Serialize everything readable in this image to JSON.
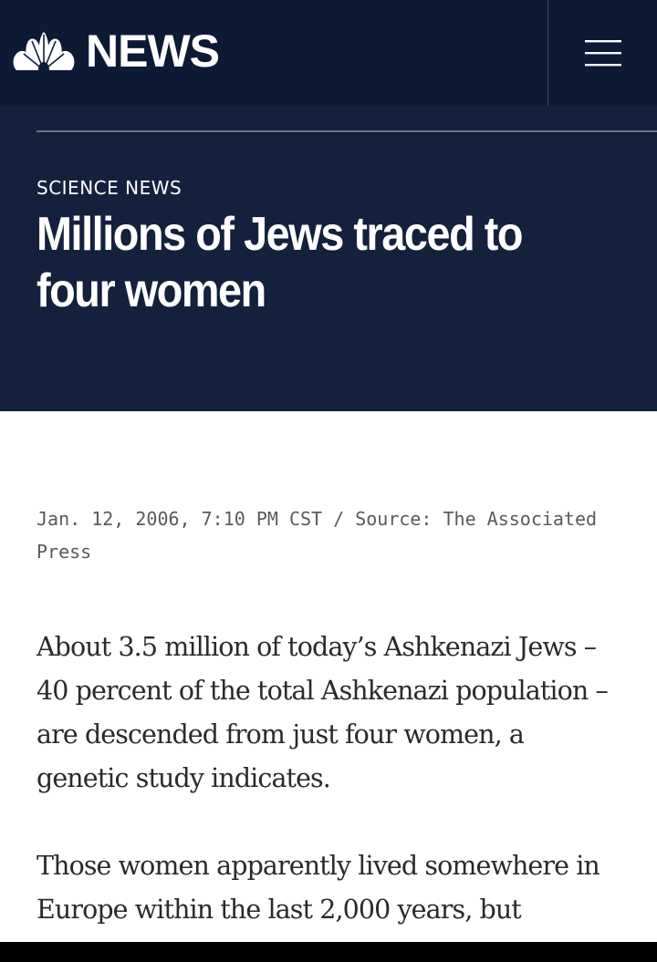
{
  "header": {
    "logo_text": "NEWS",
    "logo_icon": "peacock-icon",
    "menu_icon": "hamburger-icon"
  },
  "article": {
    "section": "SCIENCE NEWS",
    "headline": "Millions of Jews traced to four women",
    "dateline": "Jan. 12, 2006, 7:10 PM CST / Source: The Associated Press",
    "paragraphs": [
      "About 3.5 million of today’s Ashkenazi Jews – 40 percent of the total Ashkenazi population – are descended from just four women, a genetic study indicates.",
      "Those women apparently lived somewhere in Europe within the last 2,000 years, but"
    ]
  },
  "colors": {
    "topbar": "#0c1a34",
    "header_band": "#14213d",
    "text_on_dark": "#ffffff",
    "body_text": "#2a2a2a",
    "dateline_text": "#5a5a5a"
  }
}
